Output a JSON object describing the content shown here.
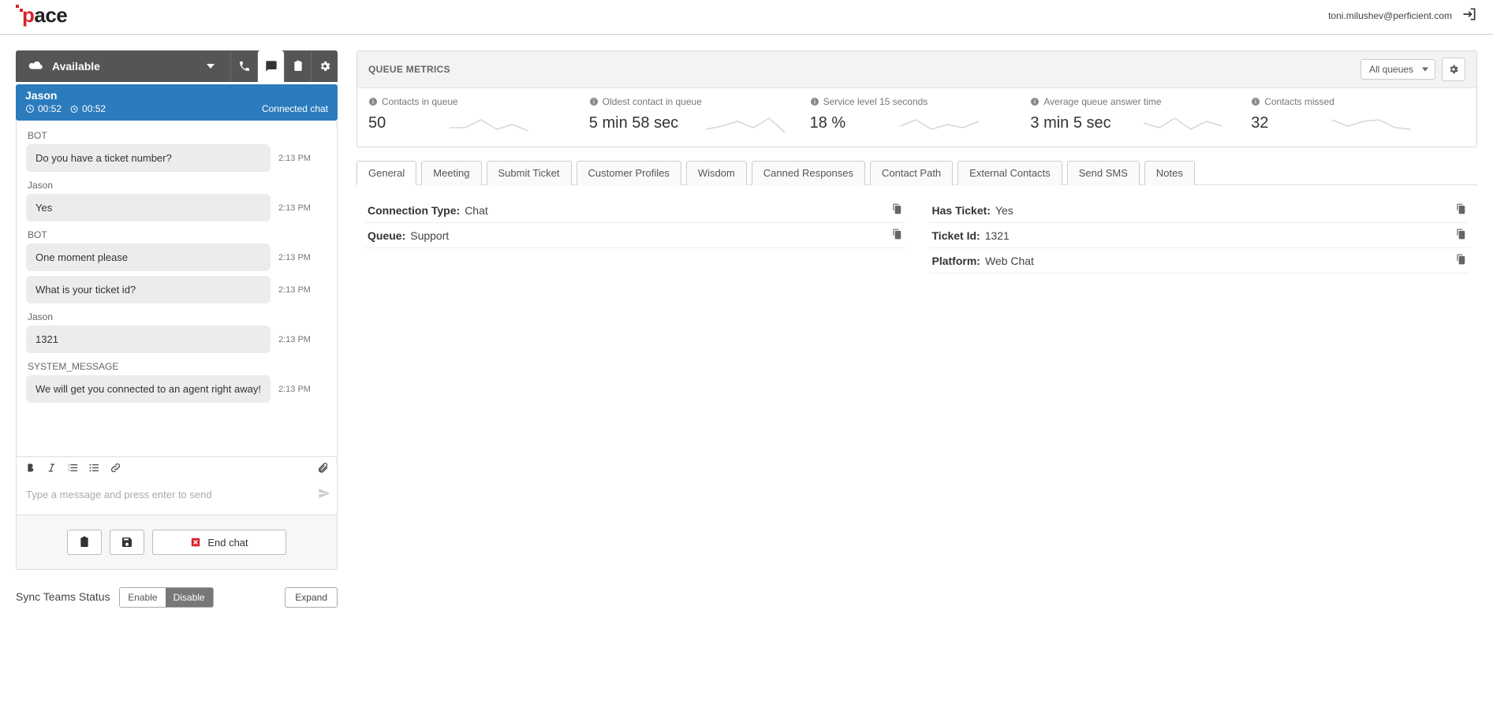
{
  "header": {
    "logo_text_p": "p",
    "logo_text_rest": "ace",
    "user_email": "toni.milushev@perficient.com"
  },
  "agent": {
    "status": "Available"
  },
  "contact": {
    "name": "Jason",
    "timer1": "00:52",
    "timer2": "00:52",
    "status": "Connected chat"
  },
  "chat": [
    {
      "sender": "BOT",
      "messages": [
        "Do you have a ticket number?"
      ],
      "time": "2:13 PM"
    },
    {
      "sender": "Jason",
      "messages": [
        "Yes"
      ],
      "time": "2:13 PM"
    },
    {
      "sender": "BOT",
      "messages": [
        "One moment please",
        "What is your ticket id?"
      ],
      "time": "2:13 PM"
    },
    {
      "sender": "Jason",
      "messages": [
        "1321"
      ],
      "time": "2:13 PM"
    },
    {
      "sender": "SYSTEM_MESSAGE",
      "messages": [
        "We will get you connected to an agent right away!"
      ],
      "time": "2:13 PM"
    }
  ],
  "compose": {
    "placeholder": "Type a message and press enter to send"
  },
  "actions": {
    "end_chat": "End chat"
  },
  "footer": {
    "sync_label": "Sync Teams Status",
    "enable": "Enable",
    "disable": "Disable",
    "expand": "Expand"
  },
  "metrics": {
    "title": "QUEUE METRICS",
    "queue_selector": "All queues",
    "items": [
      {
        "label": "Contacts in queue",
        "value": "50"
      },
      {
        "label": "Oldest contact in queue",
        "value": "5 min 58 sec"
      },
      {
        "label": "Service level 15 seconds",
        "value": "18 %"
      },
      {
        "label": "Average queue answer time",
        "value": "3 min 5 sec"
      },
      {
        "label": "Contacts missed",
        "value": "32"
      }
    ]
  },
  "tabs": [
    "General",
    "Meeting",
    "Submit Ticket",
    "Customer Profiles",
    "Wisdom",
    "Canned Responses",
    "Contact Path",
    "External Contacts",
    "Send SMS",
    "Notes"
  ],
  "info": {
    "left": [
      {
        "label": "Connection Type:",
        "value": "Chat"
      },
      {
        "label": "Queue:",
        "value": "Support"
      }
    ],
    "right": [
      {
        "label": "Has Ticket:",
        "value": "Yes"
      },
      {
        "label": "Ticket Id:",
        "value": "1321"
      },
      {
        "label": "Platform:",
        "value": "Web Chat"
      }
    ]
  }
}
